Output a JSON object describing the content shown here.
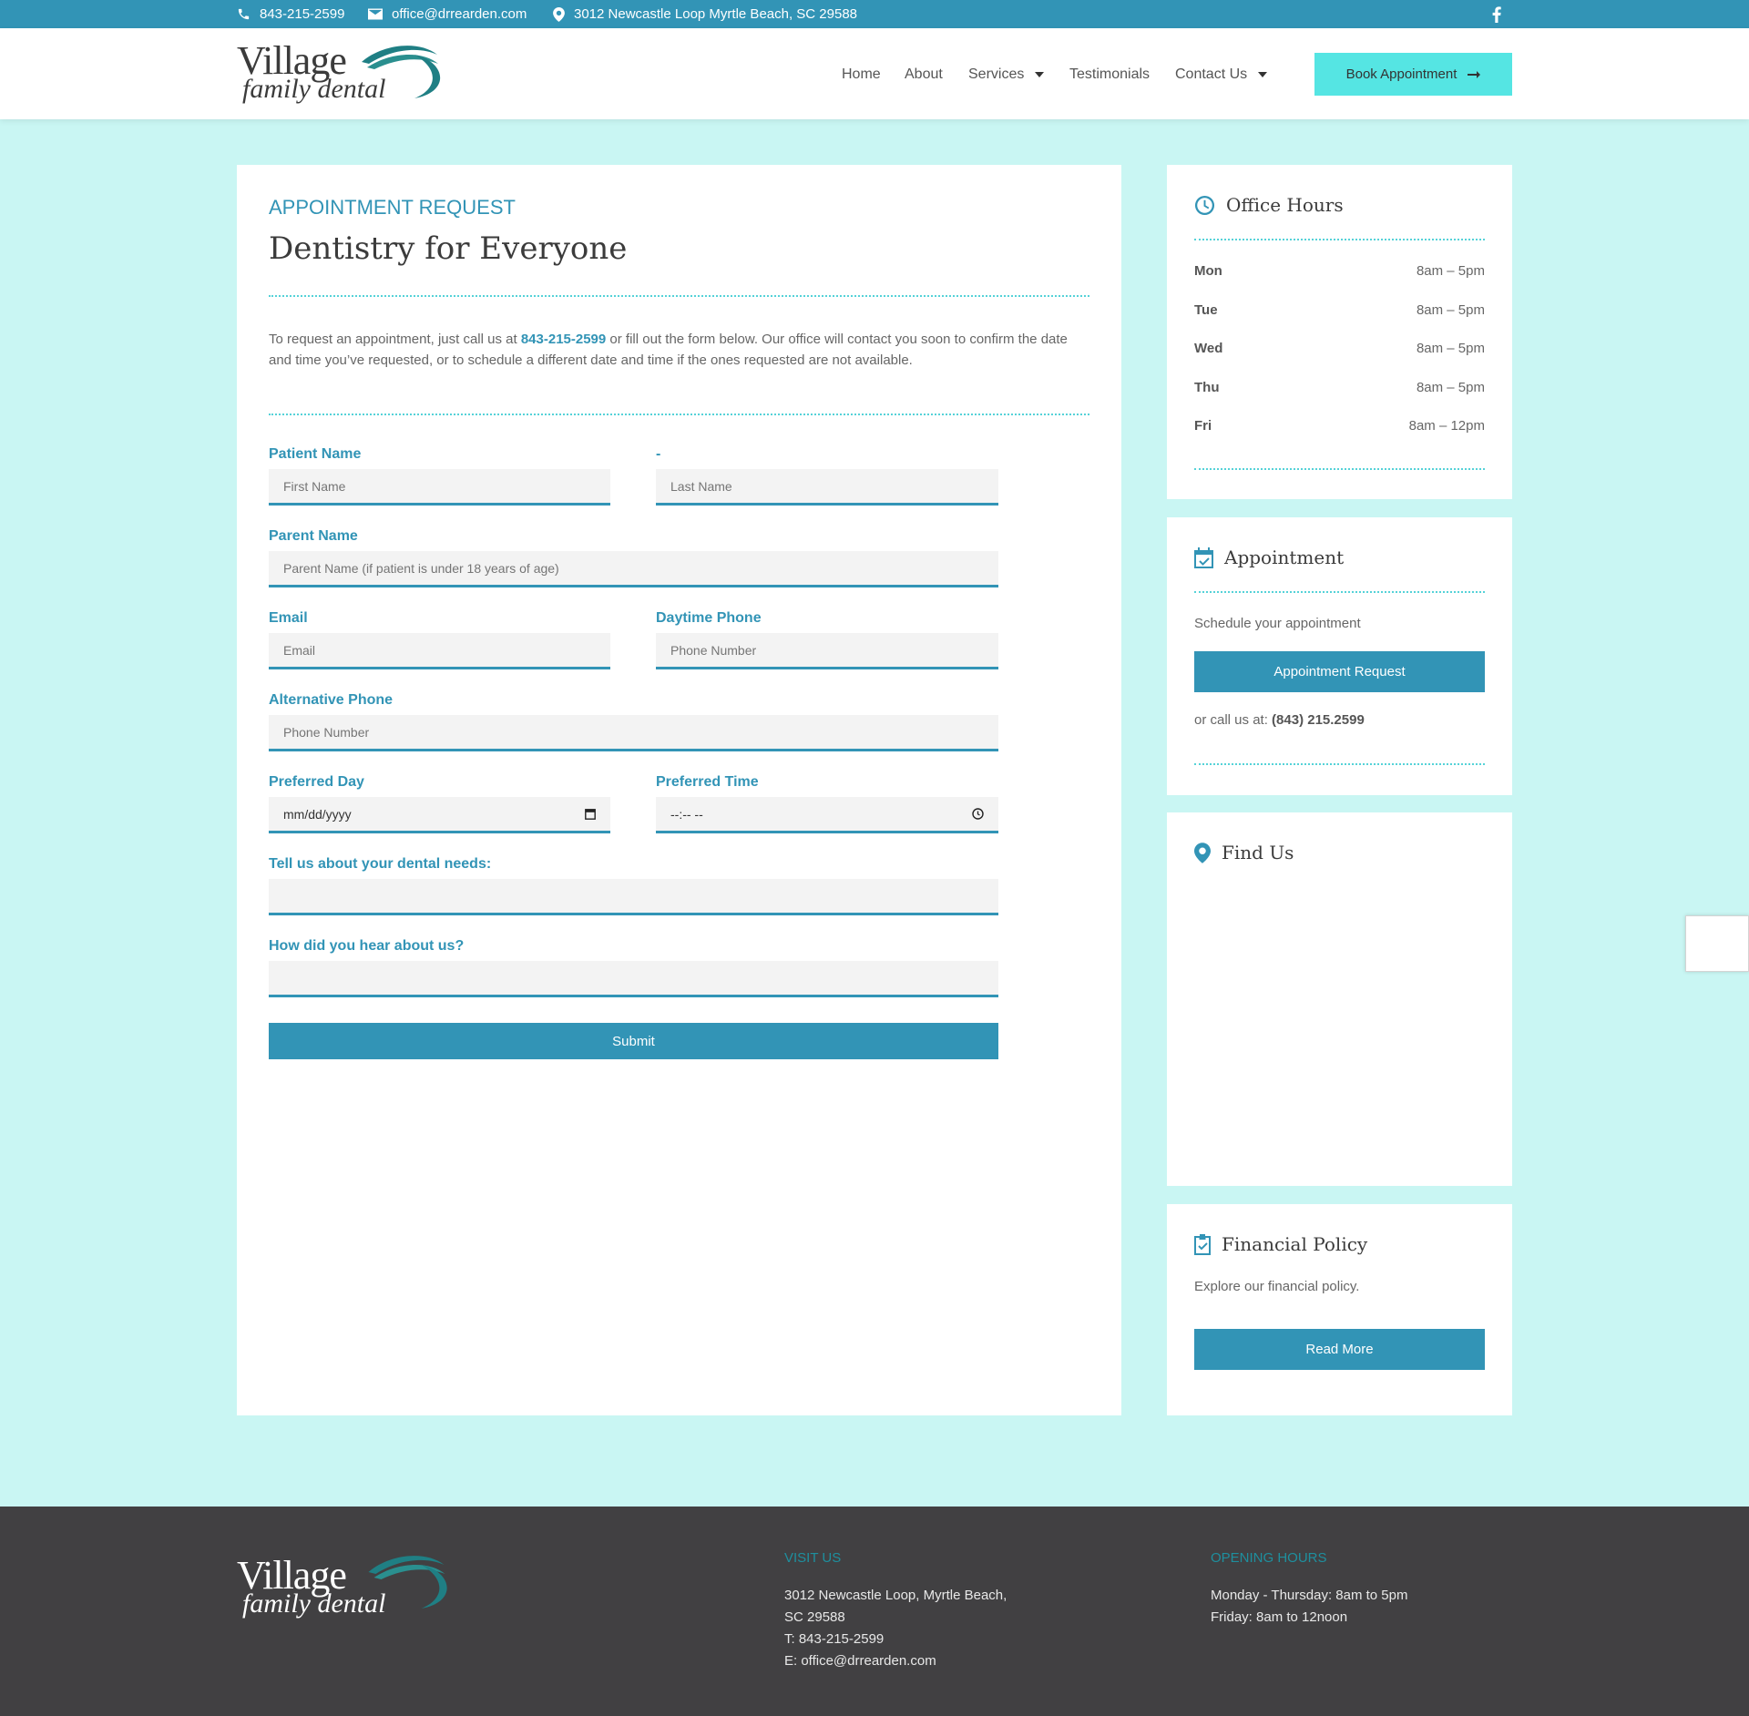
{
  "topbar": {
    "phone": "843-215-2599",
    "email": "office@drrearden.com",
    "address": "3012 Newcastle Loop Myrtle Beach, SC 29588"
  },
  "logo": {
    "line1": "Village",
    "line2": "family dental"
  },
  "nav": {
    "items": [
      {
        "label": "Home"
      },
      {
        "label": "About"
      },
      {
        "label": "Services"
      },
      {
        "label": "Testimonials"
      },
      {
        "label": "Contact Us"
      }
    ],
    "book_label": "Book Appointment"
  },
  "main": {
    "eyebrow": "APPOINTMENT REQUEST",
    "title": "Dentistry for Everyone",
    "intro_before": "To request an appointment, just call us at ",
    "intro_phone": "843-215-2599",
    "intro_after": " or fill out the form below.  Our office will contact you soon to confirm the date and time you’ve requested, or to schedule a different date and time if the ones requested are not available."
  },
  "form": {
    "patient_name_label": "Patient Name",
    "dash_label": "-",
    "first_name_placeholder": "First Name",
    "last_name_placeholder": "Last Name",
    "parent_name_label": "Parent Name",
    "parent_name_placeholder": "Parent Name (if patient is under 18 years of age)",
    "email_label": "Email",
    "email_placeholder": "Email",
    "daytime_phone_label": "Daytime Phone",
    "daytime_phone_placeholder": "Phone Number",
    "alt_phone_label": "Alternative Phone",
    "alt_phone_placeholder": "Phone Number",
    "preferred_day_label": "Preferred Day",
    "preferred_day_value": "mm/dd/yyyy",
    "preferred_time_label": "Preferred Time",
    "preferred_time_value": "--:-- --",
    "needs_label": "Tell us about your dental needs:",
    "hear_label": "How did you hear about us?",
    "submit_label": "Submit"
  },
  "sidebar": {
    "hours_title": "Office Hours",
    "hours": [
      {
        "day": "Mon",
        "time": "8am – 5pm"
      },
      {
        "day": "Tue",
        "time": "8am – 5pm"
      },
      {
        "day": "Wed",
        "time": "8am – 5pm"
      },
      {
        "day": "Thu",
        "time": "8am – 5pm"
      },
      {
        "day": "Fri",
        "time": "8am – 12pm"
      }
    ],
    "appointment_title": "Appointment",
    "appointment_text": "Schedule your appointment",
    "appointment_button": "Appointment Request",
    "call_prefix": "or call us at: ",
    "call_number": "(843) 215.2599",
    "find_title": "Find Us",
    "financial_title": "Financial Policy",
    "financial_text": "Explore our financial policy.",
    "financial_button": "Read More"
  },
  "footer": {
    "logo_line1": "Village",
    "logo_line2": "family dental",
    "visit_heading": "VISIT US",
    "visit_address1": "3012 Newcastle Loop, Myrtle Beach,",
    "visit_address2": "SC 29588",
    "visit_phone": "T: 843-215-2599",
    "visit_email": "E: office@drrearden.com",
    "hours_heading": "OPENING HOURS",
    "hours_line1": "Monday - Thursday: 8am to 5pm",
    "hours_line2": "Friday: 8am to 12noon"
  },
  "colors": {
    "brand": "#3294b6",
    "accent": "#55e5e3",
    "background": "#c9f6f3",
    "footer": "#414042"
  },
  "icons": [
    "phone-icon",
    "mail-icon",
    "map-pin-icon",
    "facebook-icon",
    "arrow-right-icon",
    "clock-icon",
    "calendar-check-icon",
    "clipboard-check-icon",
    "calendar-icon",
    "time-icon"
  ]
}
